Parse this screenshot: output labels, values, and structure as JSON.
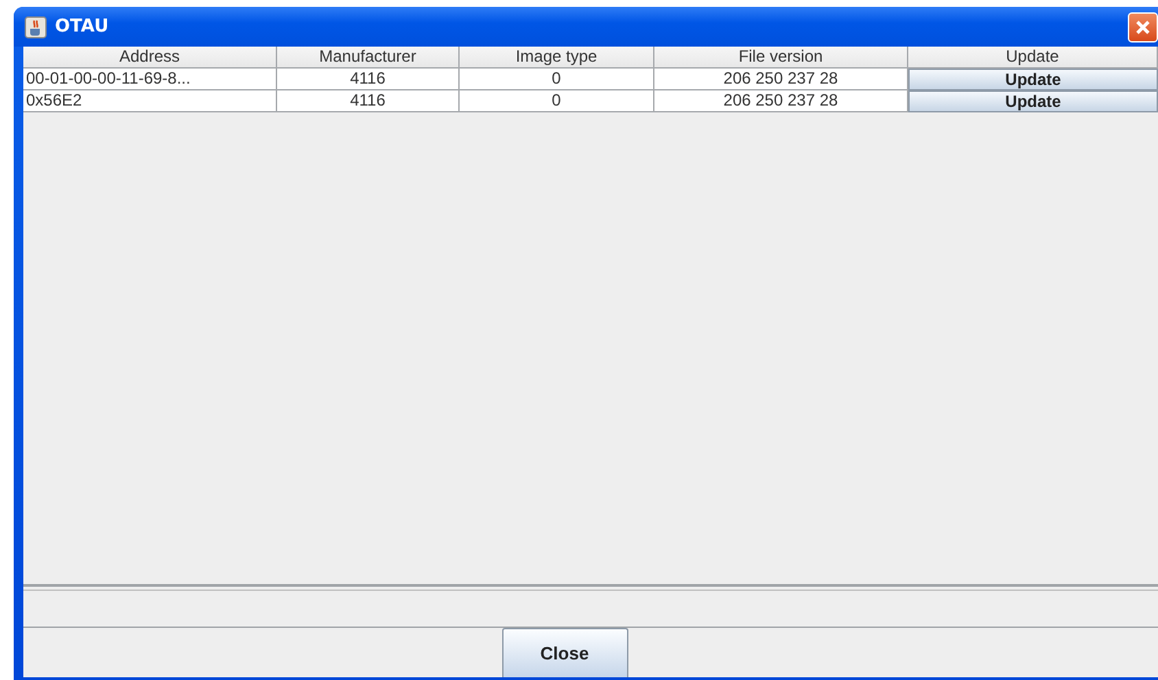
{
  "window": {
    "title": "OTAU"
  },
  "table": {
    "columns": [
      "Address",
      "Manufacturer",
      "Image type",
      "File version",
      "Update"
    ],
    "rows": [
      {
        "address": "00-01-00-00-11-69-8...",
        "manufacturer": "4116",
        "image_type": "0",
        "file_version": "206 250 237 28",
        "update": "Update"
      },
      {
        "address": "0x56E2",
        "manufacturer": "4116",
        "image_type": "0",
        "file_version": "206 250 237 28",
        "update": "Update"
      }
    ]
  },
  "buttons": [
    "Close"
  ]
}
